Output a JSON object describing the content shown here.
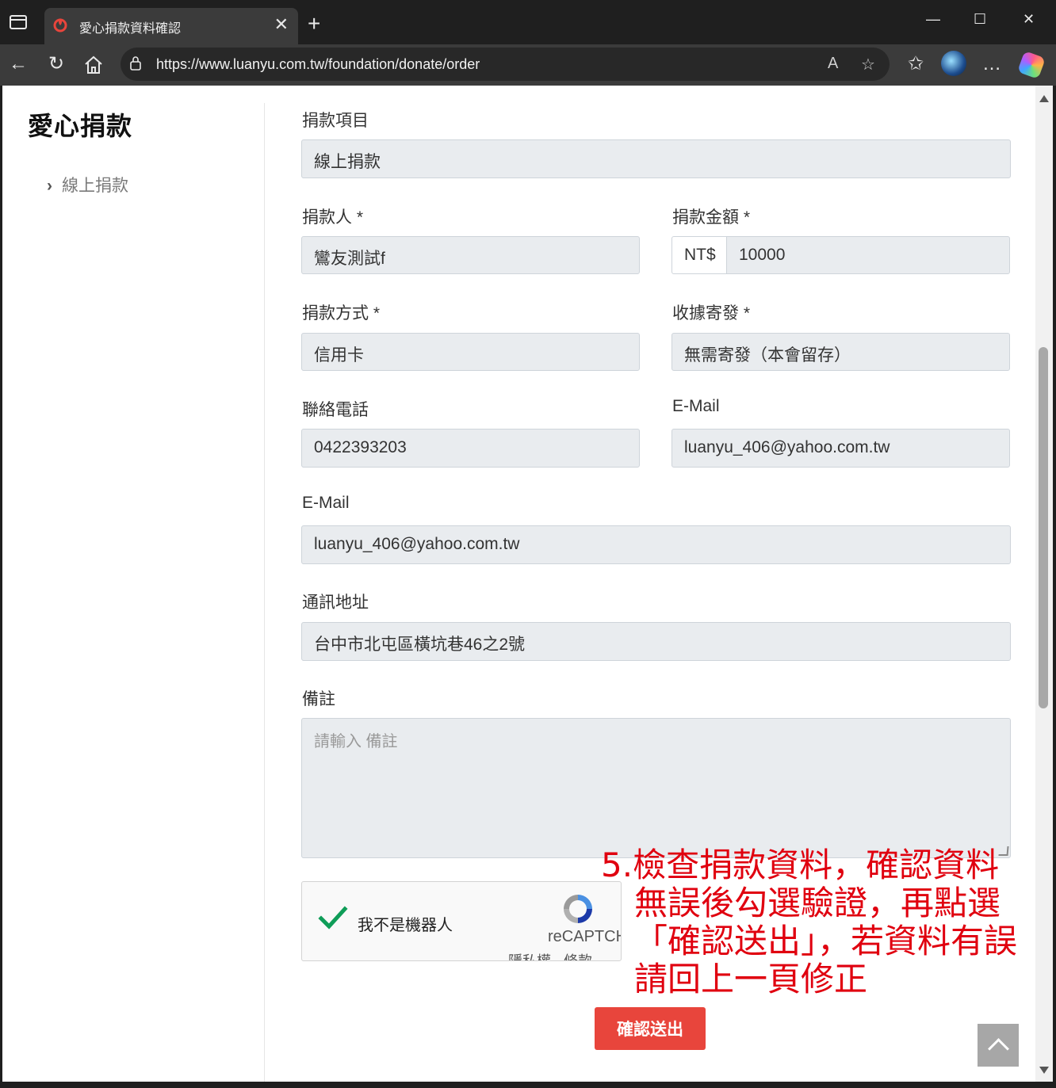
{
  "browser": {
    "tab_title": "愛心捐款資料確認",
    "new_tab": "+",
    "tab_close": "✕",
    "url": "https://www.luanyu.com.tw/foundation/donate/order",
    "window_controls": {
      "minimize": "—",
      "maximize": "☐",
      "close": "✕"
    },
    "icons": [
      "sidebar-icon",
      "back-icon",
      "refresh-icon",
      "home-icon",
      "lock-icon",
      "read-aloud-icon",
      "favorite-star-icon",
      "favorites-icon",
      "profile-avatar",
      "more-icon",
      "copilot-icon"
    ]
  },
  "sidebar": {
    "title": "愛心捐款",
    "items": [
      {
        "label": "線上捐款"
      }
    ]
  },
  "form": {
    "item": {
      "label": "捐款項目",
      "value": "線上捐款"
    },
    "donor": {
      "label": "捐款人 *",
      "value": "鸞友測試f"
    },
    "amount": {
      "label": "捐款金額 *",
      "prefix": "NT$",
      "value": "10000"
    },
    "method": {
      "label": "捐款方式 *",
      "value": "信用卡"
    },
    "receipt": {
      "label": "收據寄發 *",
      "value": "無需寄發（本會留存）"
    },
    "phone": {
      "label": "聯絡電話",
      "value": "0422393203"
    },
    "email1": {
      "label": "E-Mail",
      "value": "luanyu_406@yahoo.com.tw"
    },
    "email2": {
      "label": "E-Mail",
      "value": "luanyu_406@yahoo.com.tw"
    },
    "address": {
      "label": "通訊地址",
      "value": "台中市北屯區橫坑巷46之2號"
    },
    "note": {
      "label": "備註",
      "placeholder": "請輸入 備註"
    }
  },
  "captcha": {
    "label": "我不是機器人",
    "brand": "reCAPTCHA",
    "links": "隱私權 - 條款",
    "checked": true
  },
  "submit_label": "確認送出",
  "annotation": [
    "5.檢查捐款資料，確認資料",
    "無誤後勾選驗證，再點選",
    "「確認送出」，若資料有誤",
    "請回上一頁修正"
  ],
  "colors": {
    "accent": "#e8453c",
    "annotation": "#e0000f",
    "field_bg": "#e9ecef"
  }
}
